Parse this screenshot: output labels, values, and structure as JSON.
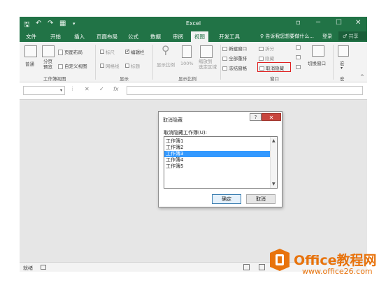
{
  "window": {
    "title": "Excel",
    "controls": [
      "▫",
      "─",
      "☐",
      "✕"
    ]
  },
  "quick_access": [
    "🖫",
    "↶",
    "↷",
    "▦",
    "▾"
  ],
  "tabs": {
    "items": [
      "文件",
      "开始",
      "插入",
      "页面布局",
      "公式",
      "数据",
      "审阅",
      "视图",
      "开发工具"
    ],
    "active": "视图",
    "tell_me": "♀ 告诉我您想要做什么...",
    "login": "登录",
    "share": "共享"
  },
  "ribbon": {
    "workbook_views": {
      "label": "工作簿视图",
      "normal": "普通",
      "page_break": "分页\n预览",
      "page_layout": "页面布局",
      "custom_views": "自定义视图"
    },
    "show": {
      "label": "显示",
      "ruler": "标尺",
      "formula_bar": "编辑栏",
      "gridlines": "网格线",
      "headings": "标题"
    },
    "zoom": {
      "label": "显示比例",
      "zoom": "显示比例",
      "hundred": "100%",
      "zoom_selection": "缩放到\n选定区域"
    },
    "window": {
      "label": "窗口",
      "new_window": "新建窗口",
      "arrange_all": "全部重排",
      "freeze_panes": "冻结窗格",
      "split": "拆分",
      "hide": "隐藏",
      "unhide": "取消隐藏",
      "switch_windows": "切换窗口"
    },
    "macros": {
      "label": "宏",
      "macros": "宏"
    }
  },
  "formula_bar": {
    "cancel": "✕",
    "enter": "✓",
    "fx": "fx"
  },
  "dialog": {
    "title": "取消隐藏",
    "help": "?",
    "close": "✕",
    "list_label": "取消隐藏工作簿(U):",
    "items": [
      "工作簿1",
      "工作簿2",
      "工作簿3",
      "工作簿4",
      "工作簿5"
    ],
    "selected_index": 2,
    "ok": "确定",
    "cancel": "取消"
  },
  "status": {
    "ready": "就绪"
  },
  "watermark": {
    "text": "Office教程网",
    "url": "www.office26.com"
  },
  "colors": {
    "excel_green": "#217346",
    "selection_blue": "#3399ff",
    "highlight_red": "#e02020",
    "watermark_orange": "#e8730c"
  }
}
